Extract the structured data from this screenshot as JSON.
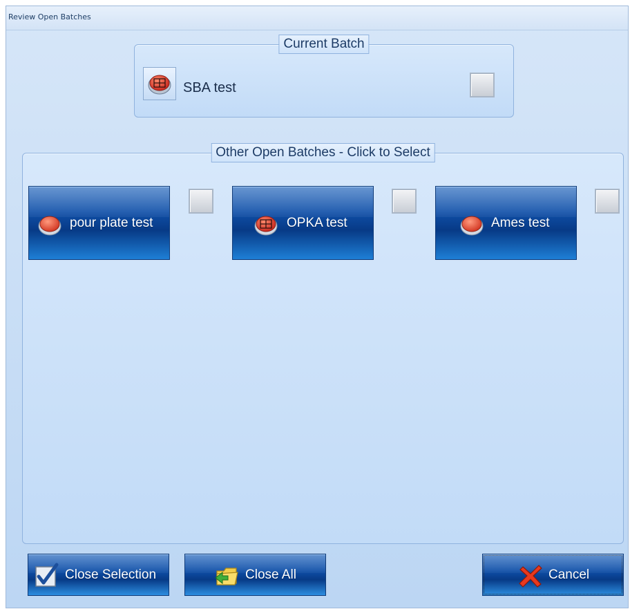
{
  "window": {
    "title": "Review Open Batches"
  },
  "current_batch": {
    "legend": "Current Batch",
    "item": {
      "label": "SBA test",
      "icon": "grid-plate-icon",
      "checked": false
    }
  },
  "other_batches": {
    "legend": "Other Open Batches - Click to Select",
    "items": [
      {
        "label": "pour plate test",
        "icon": "plain-plate-icon",
        "checked": false
      },
      {
        "label": "OPKA test",
        "icon": "grid-plate-icon",
        "checked": false
      },
      {
        "label": "Ames test",
        "icon": "plain-plate-icon",
        "checked": false
      }
    ]
  },
  "footer": {
    "close_selection_label": "Close Selection",
    "close_all_label": "Close All",
    "cancel_label": "Cancel"
  },
  "colors": {
    "button_blue": "#0f4fa8",
    "panel_bg": "#c2dbf7",
    "border": "#8fb2de",
    "plate_red": "#e2452c"
  }
}
